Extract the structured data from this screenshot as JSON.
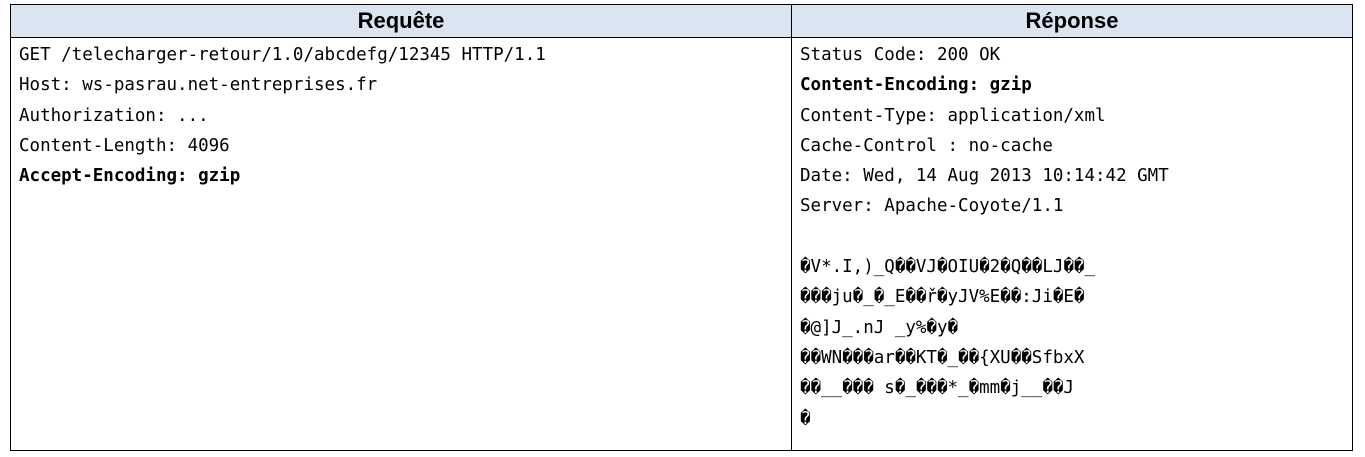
{
  "table": {
    "headers": {
      "request": "Requête",
      "response": "Réponse"
    },
    "request": {
      "lines": [
        {
          "text": "GET /telecharger-retour/1.0/abcdefg/12345 HTTP/1.1",
          "bold": false
        },
        {
          "text": "Host: ws-pasrau.net-entreprises.fr",
          "bold": false
        },
        {
          "text": "Authorization: ...",
          "bold": false
        },
        {
          "text": "Content-Length: 4096",
          "bold": false
        },
        {
          "text": "Accept-Encoding: gzip",
          "bold": true
        }
      ]
    },
    "response": {
      "lines": [
        {
          "text": "Status Code: 200 OK",
          "bold": false
        },
        {
          "text": "Content-Encoding: gzip",
          "bold": true
        },
        {
          "text": "Content-Type: application/xml",
          "bold": false
        },
        {
          "text": "Cache-Control : no-cache",
          "bold": false
        },
        {
          "text": "Date: Wed, 14 Aug 2013 10:14:42 GMT",
          "bold": false
        },
        {
          "text": "Server: Apache-Coyote/1.1",
          "bold": false
        }
      ],
      "body_lines": [
        "�V*.I,)_Q��VJ�OIU�2�Q��LJ��_",
        "���ju�_�_E��ř�yJV%E��:Ji�E�",
        "�@]J_.nJ _y%�y�",
        "��WN���ar��KT�_��{XU��SfbxX",
        "��__��� s�_���*_�mm�j__��J",
        "�"
      ]
    }
  },
  "colors": {
    "header_background": "#dbe5f1",
    "border": "#000000"
  }
}
